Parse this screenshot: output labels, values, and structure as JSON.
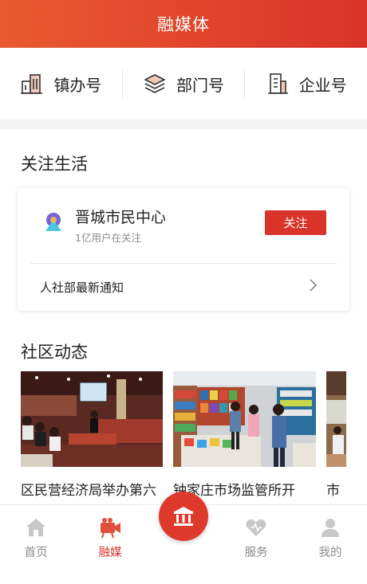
{
  "header": {
    "title": "融媒体"
  },
  "account_types": [
    {
      "label": "镇办号",
      "icon": "building-icon"
    },
    {
      "label": "部门号",
      "icon": "layers-icon"
    },
    {
      "label": "企业号",
      "icon": "office-building-icon"
    }
  ],
  "follow_section": {
    "title": "关注生活",
    "card": {
      "name": "晋城市民中心",
      "followers": "1亿用户在关注",
      "follow_button": "关注",
      "notice": "人社部最新通知"
    }
  },
  "community_section": {
    "title": "社区动态",
    "items": [
      {
        "caption": "区民营经济局举办第六"
      },
      {
        "caption": "钟家庄市场监管所开"
      },
      {
        "caption": "市"
      }
    ]
  },
  "tabbar": {
    "tabs": [
      {
        "label": "首页",
        "icon": "home-icon",
        "active": false
      },
      {
        "label": "融媒",
        "icon": "video-camera-icon",
        "active": true
      },
      {
        "label": "服务",
        "icon": "heart-icon",
        "active": false
      },
      {
        "label": "我的",
        "icon": "user-icon",
        "active": false
      }
    ],
    "center_icon": "government-building-icon"
  },
  "colors": {
    "brand": "#d9332a",
    "inactive": "#8a8a8a"
  }
}
